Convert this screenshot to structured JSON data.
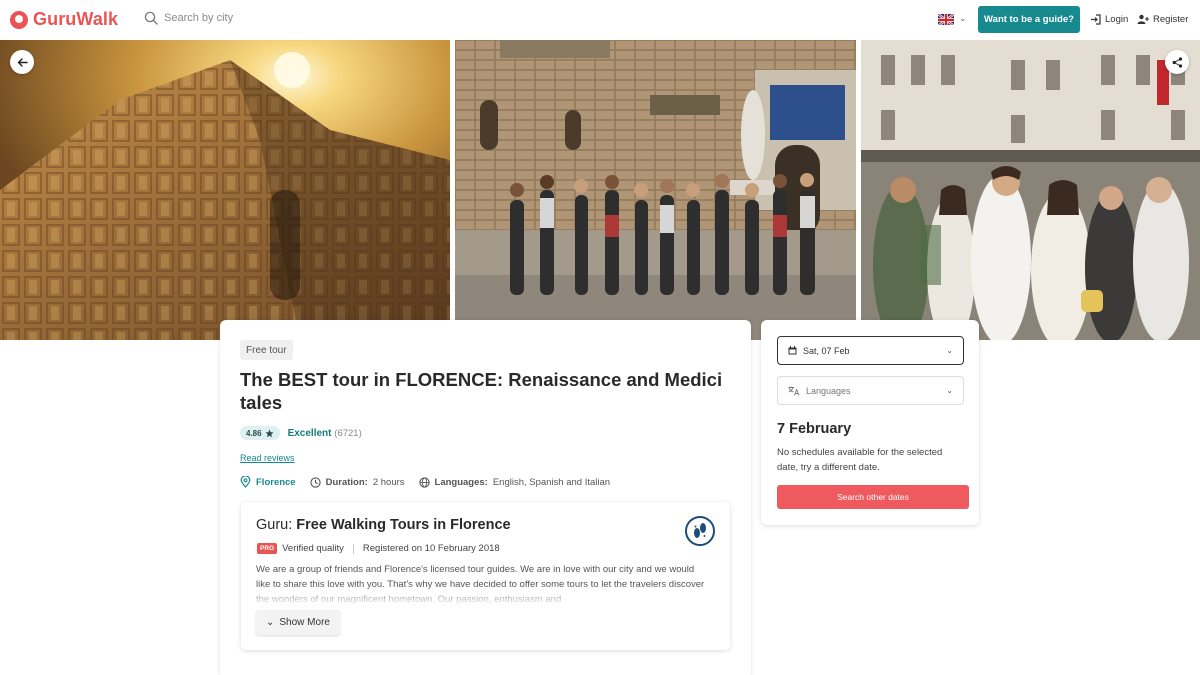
{
  "header": {
    "logo_text": "GuruWalk",
    "search_placeholder": "Search by city",
    "guide_button": "Want to be a guide?",
    "login": "Login",
    "register": "Register"
  },
  "colors": {
    "brand": "#ea5454",
    "accent": "#168a8f",
    "cta": "#ef5a5f"
  },
  "tour": {
    "tag": "Free tour",
    "title": "The BEST tour in FLORENCE: Renaissance and Medici tales",
    "rating_value": "4.86",
    "rating_label": "Excellent",
    "rating_count": "(6721)",
    "read_reviews": "Read reviews",
    "city": "Florence",
    "duration_label": "Duration:",
    "duration_value": "2 hours",
    "languages_label": "Languages:",
    "languages_value": "English, Spanish and Italian"
  },
  "guru": {
    "prefix": "Guru:",
    "name": "Free Walking Tours in Florence",
    "pro": "PRO",
    "verified": "Verified quality",
    "registered": "Registered on 10 February 2018",
    "description": "We are a group of friends and Florence's licensed tour guides. We are in love with our city and we would like to share this love with you. That's why we have decided to offer some tours to let the travelers discover the wonders of our magnificent hometown. Our passion, enthusiasm and",
    "show_more": "Show More"
  },
  "booking": {
    "date_value": "Sat, 07 Feb",
    "languages_placeholder": "Languages",
    "date_heading": "7 February",
    "no_schedule": "No schedules available for the selected date, try a different date.",
    "search_button": "Search other dates"
  }
}
